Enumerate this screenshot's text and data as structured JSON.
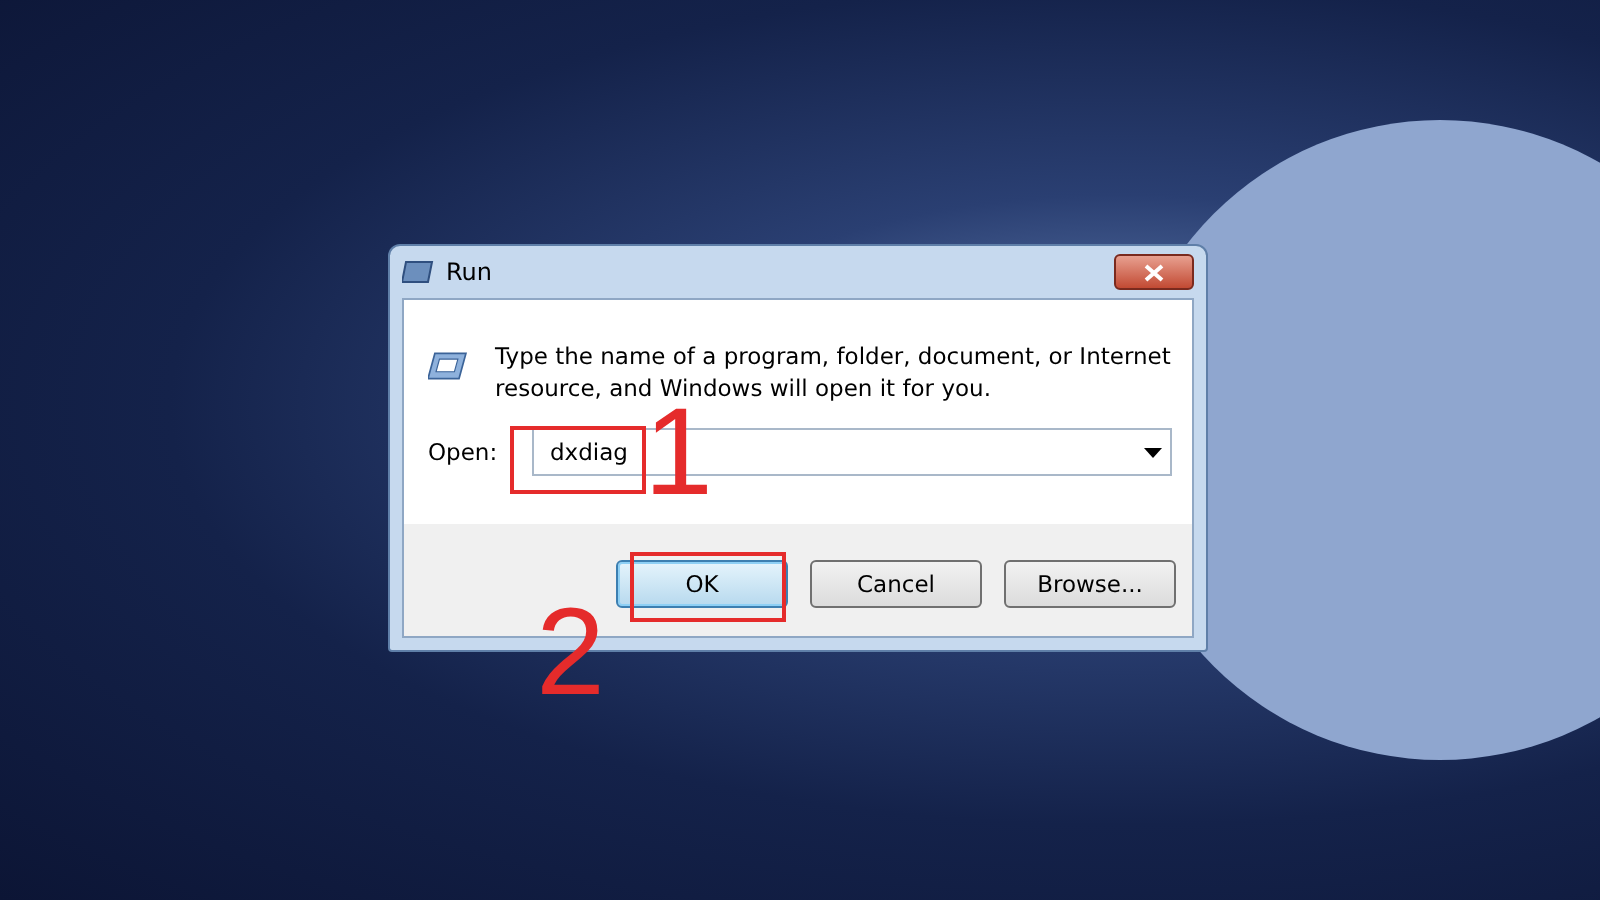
{
  "window": {
    "title": "Run"
  },
  "message": "Type the name of a program, folder, document, or Internet resource, and Windows will open it for you.",
  "open_field": {
    "label": "Open:",
    "value": "dxdiag"
  },
  "buttons": [
    {
      "label": "OK",
      "default": true
    },
    {
      "label": "Cancel",
      "default": false
    },
    {
      "label": "Browse...",
      "default": false
    }
  ],
  "annotations": [
    {
      "number": "1"
    },
    {
      "number": "2"
    }
  ]
}
